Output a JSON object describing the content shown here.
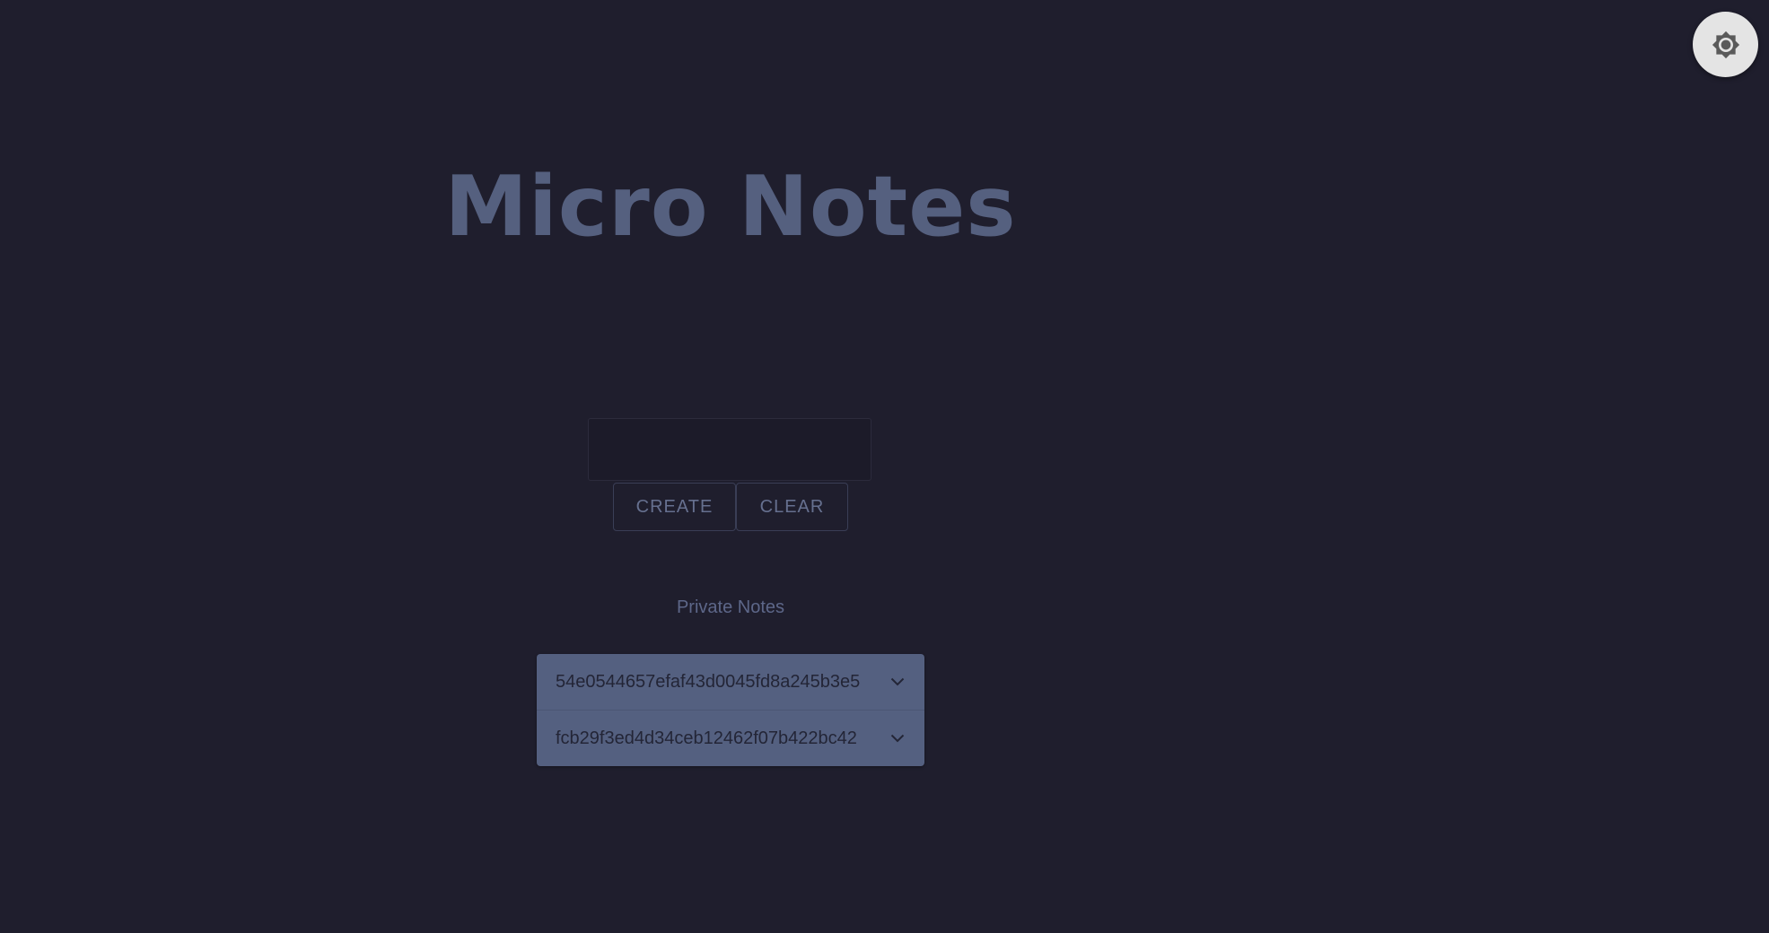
{
  "app": {
    "title": "Micro Notes"
  },
  "theme_toggle": {
    "icon": "brightness-icon"
  },
  "editor": {
    "input_value": "",
    "create_label": "CREATE",
    "clear_label": "CLEAR"
  },
  "private_notes": {
    "heading": "Private Notes",
    "items": [
      {
        "id": "54e0544657efaf43d0045fd8a245b3e5",
        "icon": "chevron-down-icon"
      },
      {
        "id": "fcb29f3ed4d34ceb12462f07b422bc42",
        "icon": "chevron-down-icon"
      }
    ]
  },
  "colors": {
    "background": "#1f1e2d",
    "title": "#55607f",
    "list_background": "#546080",
    "toggle_background": "#e4e4e4"
  }
}
